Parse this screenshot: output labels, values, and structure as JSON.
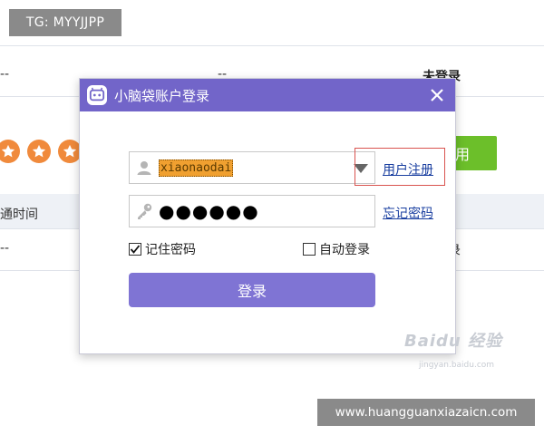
{
  "watermarks": {
    "tg": "TG: MYYJJPP",
    "url": "www.huangguanxiazaicn.com",
    "baidu": "Baidu 经验",
    "baidu_sub": "jingyan.baidu.com"
  },
  "background": {
    "row1": {
      "col1": "--",
      "col2": "--",
      "col3": "未登录"
    },
    "row2": {
      "button_label": "用"
    },
    "row3": {
      "header": "通时间"
    },
    "row4": {
      "col1": "--",
      "col3": "录"
    },
    "star_count": 3,
    "colors": {
      "star": "#f08a3c",
      "button": "#6cbf2a"
    }
  },
  "dialog": {
    "title": "小脑袋账户登录",
    "username": {
      "value": "xiaonaodai",
      "icon": "user-icon"
    },
    "password": {
      "mask": "●●●●●●",
      "icon": "key-icon"
    },
    "register_link": "用户注册",
    "forgot_link": "忘记密码",
    "remember": {
      "label": "记住密码",
      "checked": true
    },
    "auto_login": {
      "label": "自动登录",
      "checked": false
    },
    "login_button": "登录",
    "colors": {
      "header": "#7265c9",
      "button": "#7f74d4"
    }
  }
}
